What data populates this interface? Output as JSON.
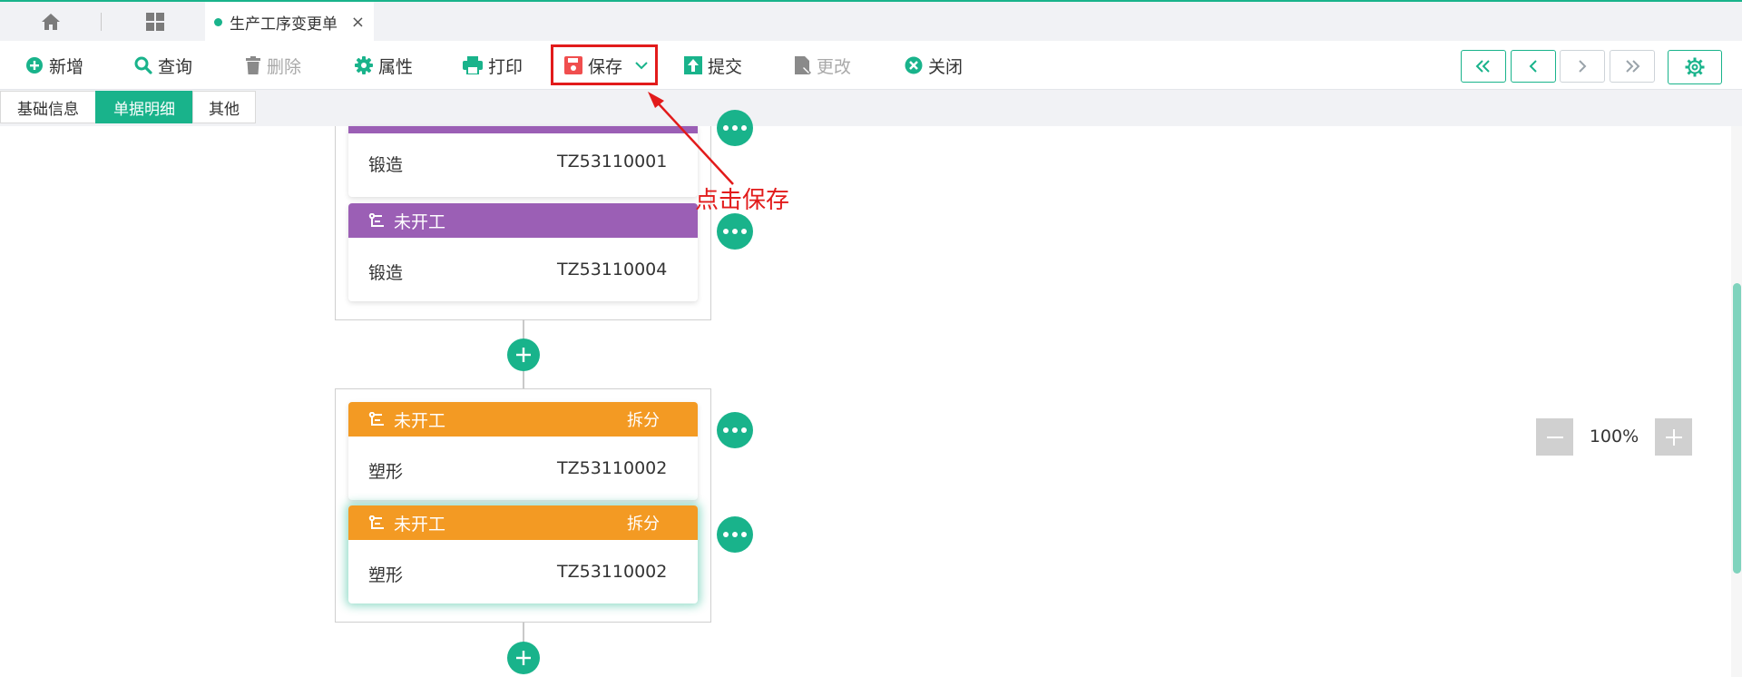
{
  "tabbar": {
    "icons": [
      "home-icon",
      "grid-icon"
    ],
    "doc_tab": {
      "title": "生产工序变更单",
      "close": "×"
    }
  },
  "toolbar": {
    "new": "新增",
    "query": "查询",
    "delete": "删除",
    "properties": "属性",
    "print": "打印",
    "save": "保存",
    "submit": "提交",
    "modify": "更改",
    "close": "关闭"
  },
  "subtabs": [
    "基础信息",
    "单据明细",
    "其他"
  ],
  "subtabs_active": 1,
  "cards": [
    {
      "status": "",
      "name": "锻造",
      "code": "TZ53110001",
      "color": "#9b5fb5"
    },
    {
      "status": "未开工",
      "name": "锻造",
      "code": "TZ53110004",
      "color": "#9b5fb5"
    },
    {
      "status": "未开工",
      "split": "拆分",
      "name": "塑形",
      "code": "TZ53110002",
      "color": "#f39a23"
    },
    {
      "status": "未开工",
      "split": "拆分",
      "name": "塑形",
      "code": "TZ53110002",
      "color": "#f39a23",
      "selected": true
    }
  ],
  "annotation": {
    "text": "点击保存",
    "color": "#e21b1b"
  },
  "zoom": {
    "value": "100%"
  },
  "colors": {
    "accent": "#19b38b",
    "purple": "#9b5fb5",
    "orange": "#f39a23",
    "highlight": "#e21b1b"
  }
}
